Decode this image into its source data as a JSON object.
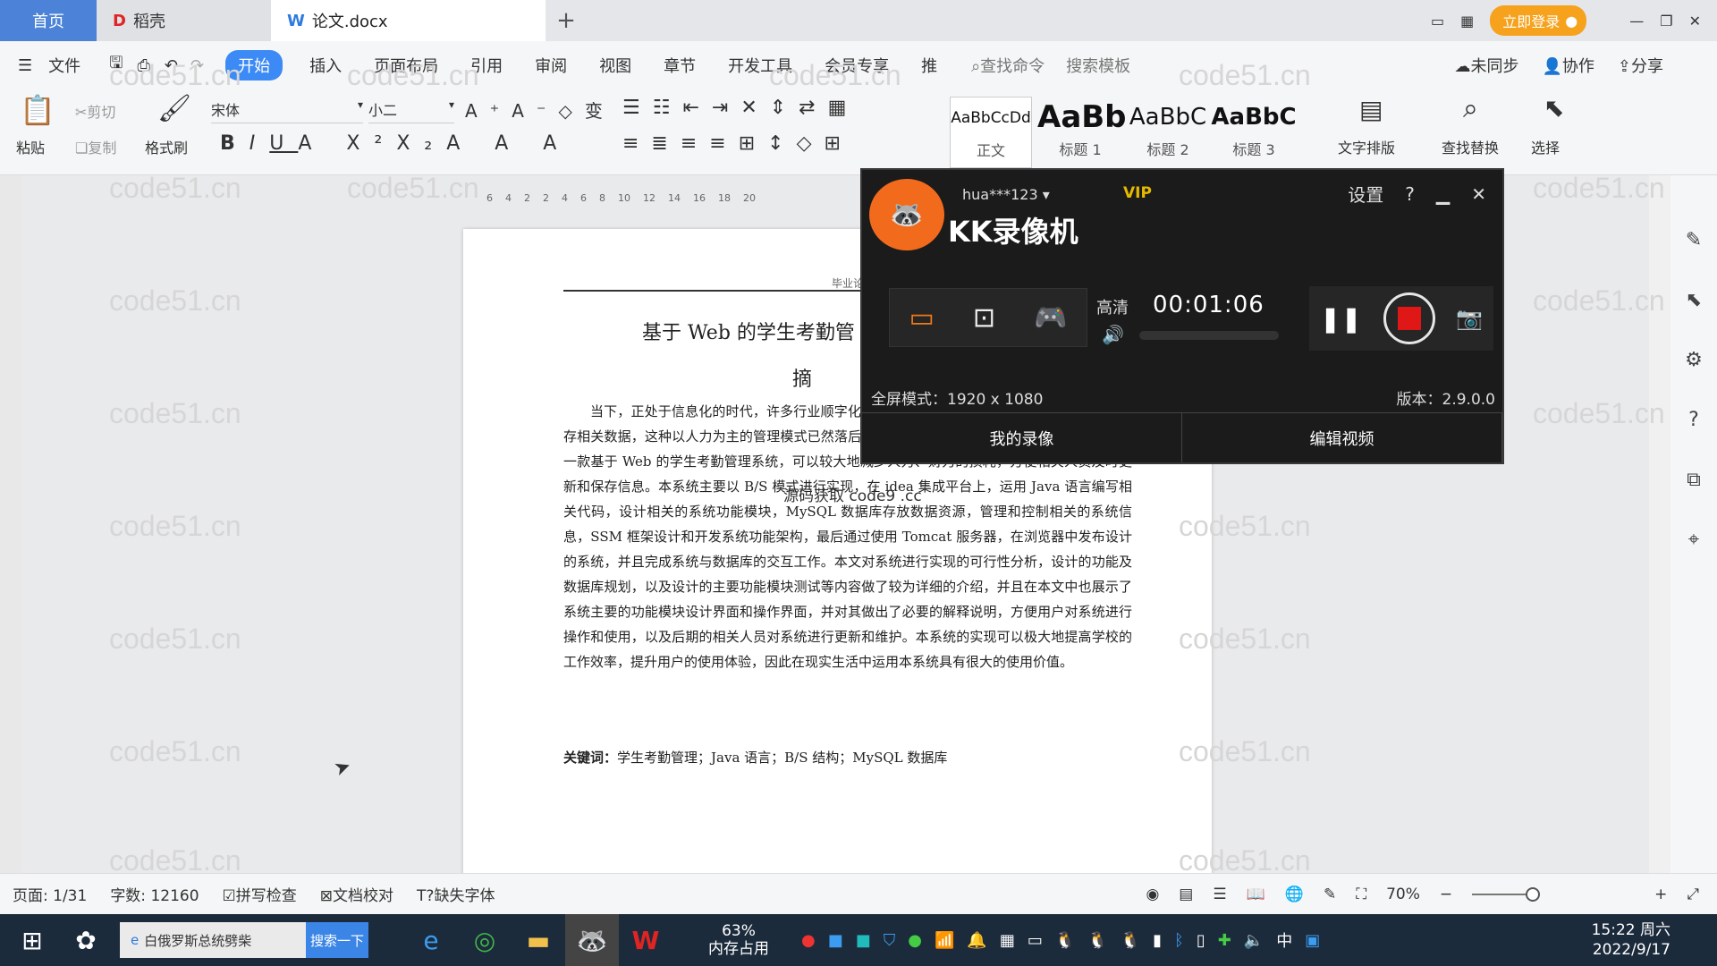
{
  "tabs": {
    "home": "首页",
    "daoke": "稻壳",
    "doc": "论文.docx",
    "login": "立即登录"
  },
  "menu": {
    "file": "文件",
    "items": [
      "开始",
      "插入",
      "页面布局",
      "引用",
      "审阅",
      "视图",
      "章节",
      "开发工具",
      "会员专享",
      "推"
    ],
    "search_cmd": "查找命令",
    "search_tpl": "搜索模板",
    "unsync": "未同步",
    "collab": "协作",
    "share": "分享"
  },
  "ribbon": {
    "paste": "粘贴",
    "cut": "剪切",
    "copy": "复制",
    "format_painter": "格式刷",
    "font": "宋体",
    "size": "小二",
    "style_normal": "正文",
    "style_h1": "标题 1",
    "style_h2": "标题 2",
    "style_h3": "标题 3",
    "sample_normal": "AaBbCcDd",
    "sample_h1": "AaBb",
    "sample_h2": "AaBbC",
    "sample_h3": "AaBbC",
    "typeset": "文字排版",
    "find_replace": "查找替换",
    "select": "选择"
  },
  "doc": {
    "header": "毕业论文",
    "title": "基于 Web 的学生考勤管",
    "abstract_title": "摘",
    "body": "当下，正处于信息化的时代，许多行业顺字化、信息化建设迈进。以前学校对于学生考式保存相关数据，这种以人力为主的管理模式已然落后。本人结合使用主流的程序开发技术，设计了一款基于 Web 的学生考勤管理系统，可以较大地减少人力、财力的损耗，方便相关人员及时更新和保存信息。本系统主要以 B/S 模式进行实现，在 idea 集成平台上，运用 Java 语言编写相关代码，设计相关的系统功能模块，MySQL 数据库存放数据资源，管理和控制相关的系统信息，SSM 框架设计和开发系统功能架构，最后通过使用 Tomcat 服务器，在浏览器中发布设计的系统，并且完成系统与数据库的交互工作。本文对系统进行实现的可行性分析，设计的功能及数据库规划，以及设计的主要功能模块测试等内容做了较为详细的介绍，并且在本文中也展示了系统主要的功能模块设计界面和操作界面，并对其做出了必要的解释说明，方便用户对系统进行操作和使用，以及后期的相关人员对系统进行更新和维护。本系统的实现可以极大地提高学校的工作效率，提升用户的使用体验，因此在现实生活中运用本系统具有很大的使用价值。",
    "keywords_label": "关键词：",
    "keywords": "学生考勤管理；Java 语言；B/S 结构；MySQL 数据库",
    "source": "源码获取 code9 .cc"
  },
  "watermark": "code51.cn",
  "kk": {
    "user": "hua***123",
    "vip": "VIP",
    "name": "KK录像机",
    "settings": "设置",
    "quality": "高清",
    "time": "00:01:06",
    "mode": "全屏模式：1920 x 1080",
    "version": "版本：2.9.0.0",
    "my_videos": "我的录像",
    "edit_video": "编辑视频"
  },
  "status": {
    "page": "页面: 1/31",
    "words": "字数: 12160",
    "spell": "拼写检查",
    "proof": "文档校对",
    "missing_font": "缺失字体",
    "zoom": "70%"
  },
  "taskbar": {
    "search_text": "白俄罗斯总统劈柴",
    "search_btn": "搜索一下",
    "mem_pct": "63%",
    "mem_label": "内存占用",
    "ime": "中",
    "time": "15:22 周六",
    "date": "2022/9/17"
  }
}
